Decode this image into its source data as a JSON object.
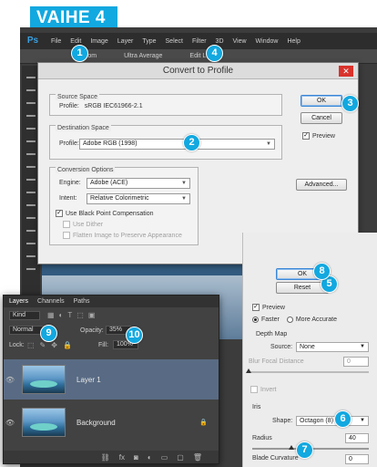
{
  "step_title": "VAIHE 4",
  "photoshop": {
    "logo": "Ps",
    "menu": [
      "File",
      "Edit",
      "Image",
      "Layer",
      "Type",
      "Select",
      "Filter",
      "3D",
      "View",
      "Window",
      "Help"
    ],
    "options_bar": [
      "Custom",
      "Ultra Average",
      "Edit Layer"
    ]
  },
  "dialog": {
    "title": "Convert to Profile",
    "source_space": {
      "label": "Source Space",
      "profile_label": "Profile:",
      "profile_value": "sRGB IEC61966-2.1"
    },
    "destination_space": {
      "label": "Destination Space",
      "profile_label": "Profile:",
      "profile_value": "Adobe RGB (1998)"
    },
    "conversion_options": {
      "label": "Conversion Options",
      "engine_label": "Engine:",
      "engine_value": "Adobe (ACE)",
      "intent_label": "Intent:",
      "intent_value": "Relative Colorimetric",
      "use_bpc": "Use Black Point Compensation",
      "use_dither": "Use Dither",
      "flatten": "Flatten Image to Preserve Appearance"
    },
    "ok_label": "OK",
    "cancel_label": "Cancel",
    "preview_label": "Preview",
    "advanced_label": "Advanced..."
  },
  "filter_panel": {
    "ok_label": "OK",
    "reset_label": "Reset",
    "preview_label": "Preview",
    "faster_label": "Faster",
    "more_accurate_label": "More Accurate",
    "depth_map_label": "Depth Map",
    "source_label": "Source:",
    "source_value": "None",
    "blur_focal_label": "Blur Focal Distance",
    "blur_focal_value": "0",
    "invert_label": "Invert",
    "iris_label": "Iris",
    "shape_label": "Shape:",
    "shape_value": "Octagon (8)",
    "radius_label": "Radius",
    "radius_value": "40",
    "blade_curvature_label": "Blade Curvature",
    "blade_curvature_value": "0"
  },
  "layers_panel": {
    "tabs": [
      "Layers",
      "Channels",
      "Paths"
    ],
    "kind_label": "Kind",
    "blend_mode": "Normal",
    "opacity_label": "Opacity:",
    "opacity_value": "35%",
    "lock_label": "Lock:",
    "fill_label": "Fill:",
    "fill_value": "100%",
    "layers": [
      "Layer 1",
      "Background"
    ]
  },
  "callouts": [
    "1",
    "2",
    "3",
    "4",
    "5",
    "6",
    "7",
    "8",
    "9",
    "10"
  ]
}
